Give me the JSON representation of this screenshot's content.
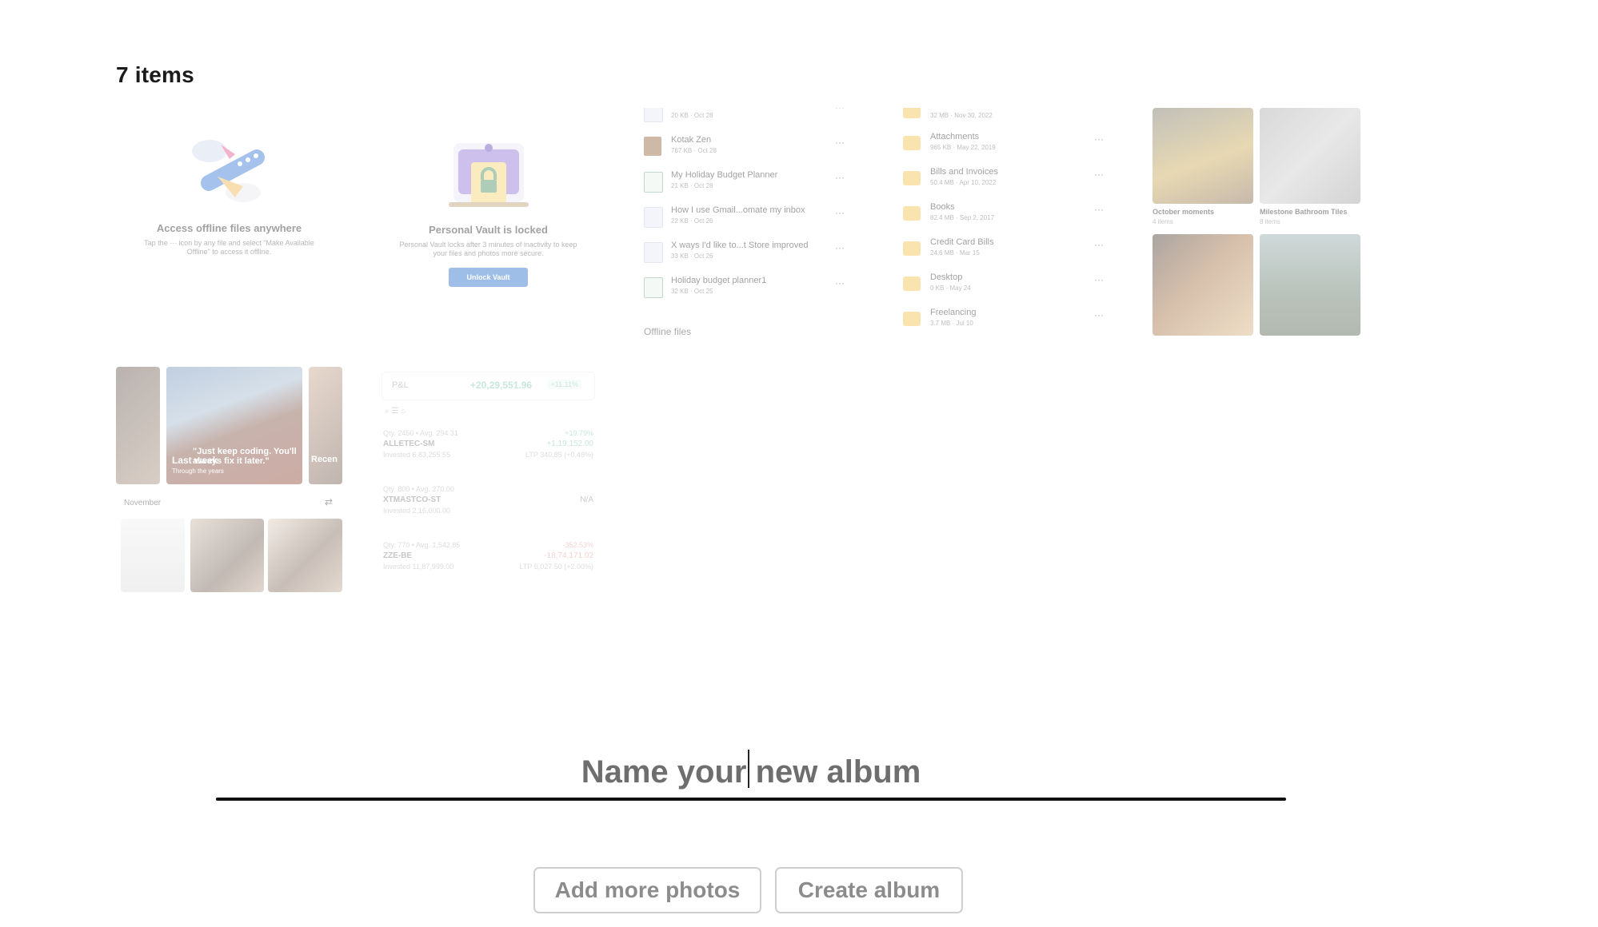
{
  "header": {
    "item_count": "7 items"
  },
  "tiles": {
    "offline": {
      "title": "Access offline files anywhere",
      "subtitle": "Tap the ··· icon by any file and select \"Make Available Offline\" to access it offline."
    },
    "vault": {
      "title": "Personal Vault is locked",
      "subtitle": "Personal Vault locks after 3 minutes of inactivity to keep your files and photos more secure.",
      "button": "Unlock Vault"
    },
    "files": {
      "items": [
        {
          "name": "",
          "meta": "20 KB · Oct 28",
          "type": "doc"
        },
        {
          "name": "Kotak Zen",
          "meta": "767 KB · Oct 28",
          "type": "img"
        },
        {
          "name": "My Holiday Budget Planner",
          "meta": "21 KB · Oct 28",
          "type": "xls"
        },
        {
          "name": "How I use Gmail...omate my inbox",
          "meta": "22 KB · Oct 26",
          "type": "doc"
        },
        {
          "name": "X ways I'd like to...t Store improved",
          "meta": "33 KB · Oct 26",
          "type": "doc"
        },
        {
          "name": "Holiday budget planner1",
          "meta": "32 KB · Oct 25",
          "type": "xls"
        }
      ],
      "section_label": "Offline files",
      "more_glyph": "···"
    },
    "folders": {
      "items": [
        {
          "name": "",
          "meta": "32 MB · Nov 30, 2022"
        },
        {
          "name": "Attachments",
          "meta": "965 KB · May 22, 2019"
        },
        {
          "name": "Bills and Invoices",
          "meta": "50.4 MB · Apr 10, 2022"
        },
        {
          "name": "Books",
          "meta": "82.4 MB · Sep 2, 2017"
        },
        {
          "name": "Credit Card Bills",
          "meta": "24.6 MB · Mar 15"
        },
        {
          "name": "Desktop",
          "meta": "0 KB · May 24"
        },
        {
          "name": "Freelancing",
          "meta": "3.7 MB · Jul 10"
        }
      ]
    },
    "albums": {
      "items": [
        {
          "name": "October moments",
          "count": "4 items"
        },
        {
          "name": "Milestone Bathroom Tiles",
          "count": "8 items"
        }
      ]
    },
    "memories": {
      "quote": "\"Just keep coding. You'll always fix it later.\"",
      "last_week": "Last week",
      "last_week_sub": "Through the years",
      "recent": "Recen",
      "month": "November"
    },
    "portfolio": {
      "pnl_label": "P&L",
      "pnl_value": "+20,29,551.96",
      "pnl_pct": "+11.11%",
      "rows": [
        {
          "qty": "Qty. 2450 • Avg. 294.31",
          "symbol": "ALLETEC-SM",
          "invested": "Invested 6,83,255.55",
          "change": "+19.79%",
          "value": "+1,19,152.00",
          "ltp": "LTP 340.85 (+0.46%)"
        },
        {
          "qty": "Qty. 800 • Avg. 270.00",
          "symbol": "XTMASTCO-ST",
          "invested": "Invested 2,16,000.00",
          "change": "",
          "value": "N/A",
          "ltp": ""
        },
        {
          "qty": "Qty. 770 • Avg. 1,542.85",
          "symbol": "ZZE-BE",
          "invested": "Invested 11,87,999.00",
          "change": "-352.53%",
          "value": "-18,74,171.02",
          "ltp": "LTP 6,027.50 (+2.00%)"
        }
      ]
    }
  },
  "album_form": {
    "placeholder": "Name your new album",
    "value": ""
  },
  "buttons": {
    "add_more_photos": "Add more photos",
    "create_album": "Create album"
  },
  "colors": {
    "accent_blue": "#1a66c9",
    "button_text": "#8c8c8c",
    "input_text": "#6e6e6e",
    "underline": "#111111",
    "folder": "#f2c046"
  }
}
